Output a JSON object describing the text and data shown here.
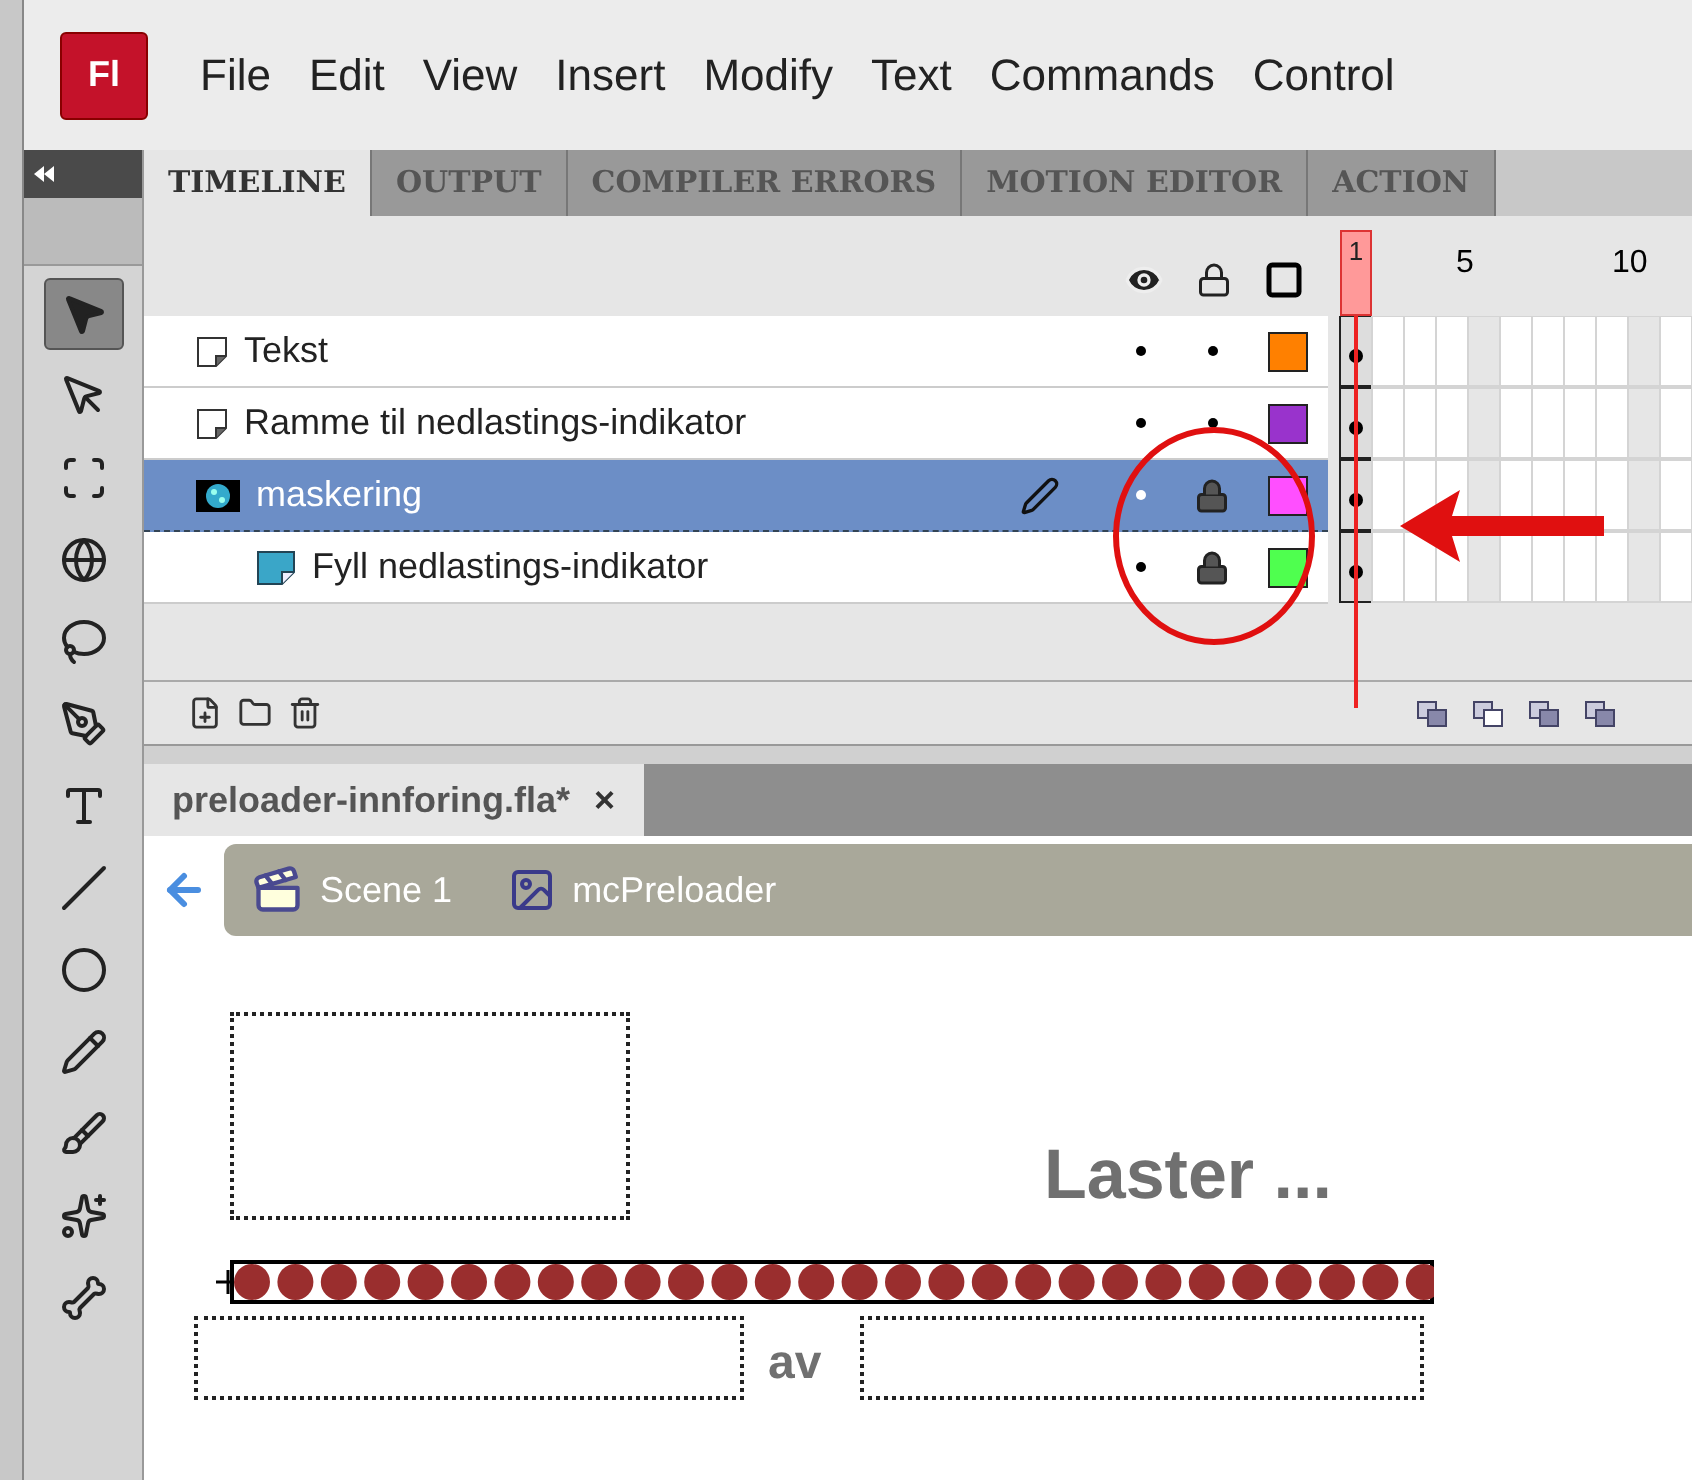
{
  "app": {
    "logo": "Fl"
  },
  "menu": [
    "File",
    "Edit",
    "View",
    "Insert",
    "Modify",
    "Text",
    "Commands",
    "Control"
  ],
  "tools": [
    {
      "kind": "selection",
      "selected": true
    },
    {
      "kind": "subselection",
      "selected": false
    },
    {
      "kind": "transform",
      "selected": false
    },
    {
      "kind": "rotation",
      "selected": false
    },
    {
      "kind": "lasso",
      "selected": false
    },
    {
      "kind": "pen",
      "selected": false
    },
    {
      "kind": "text",
      "selected": false
    },
    {
      "kind": "line",
      "selected": false
    },
    {
      "kind": "oval",
      "selected": false
    },
    {
      "kind": "pencil",
      "selected": false
    },
    {
      "kind": "brush",
      "selected": false
    },
    {
      "kind": "deco",
      "selected": false
    },
    {
      "kind": "bone",
      "selected": false
    }
  ],
  "panel_tabs": [
    {
      "label": "TIMELINE",
      "selected": true
    },
    {
      "label": "OUTPUT",
      "selected": false
    },
    {
      "label": "COMPILER ERRORS",
      "selected": false
    },
    {
      "label": "MOTION EDITOR",
      "selected": false
    },
    {
      "label": "ACTION",
      "selected": false
    }
  ],
  "timeline": {
    "current_frame": "1",
    "frame_numbers": [
      "5",
      "10"
    ],
    "layers": [
      {
        "name": "Tekst",
        "kind": "normal",
        "selected": false,
        "visible": true,
        "locked": false,
        "color": "#ff8000"
      },
      {
        "name": "Ramme til nedlastings-indikator",
        "kind": "normal",
        "selected": false,
        "visible": true,
        "locked": false,
        "color": "#9933cc"
      },
      {
        "name": "maskering",
        "kind": "mask",
        "selected": true,
        "visible": true,
        "locked": true,
        "color": "#ff4fff"
      },
      {
        "name": "Fyll nedlastings-indikator",
        "kind": "masked",
        "selected": false,
        "visible": true,
        "locked": true,
        "color": "#4fff4f"
      }
    ]
  },
  "document": {
    "tab": "preloader-innforing.fla*",
    "close": "×",
    "breadcrumb": [
      "Scene 1",
      "mcPreloader"
    ]
  },
  "stage": {
    "heading": "Laster ...",
    "separator": "av"
  }
}
